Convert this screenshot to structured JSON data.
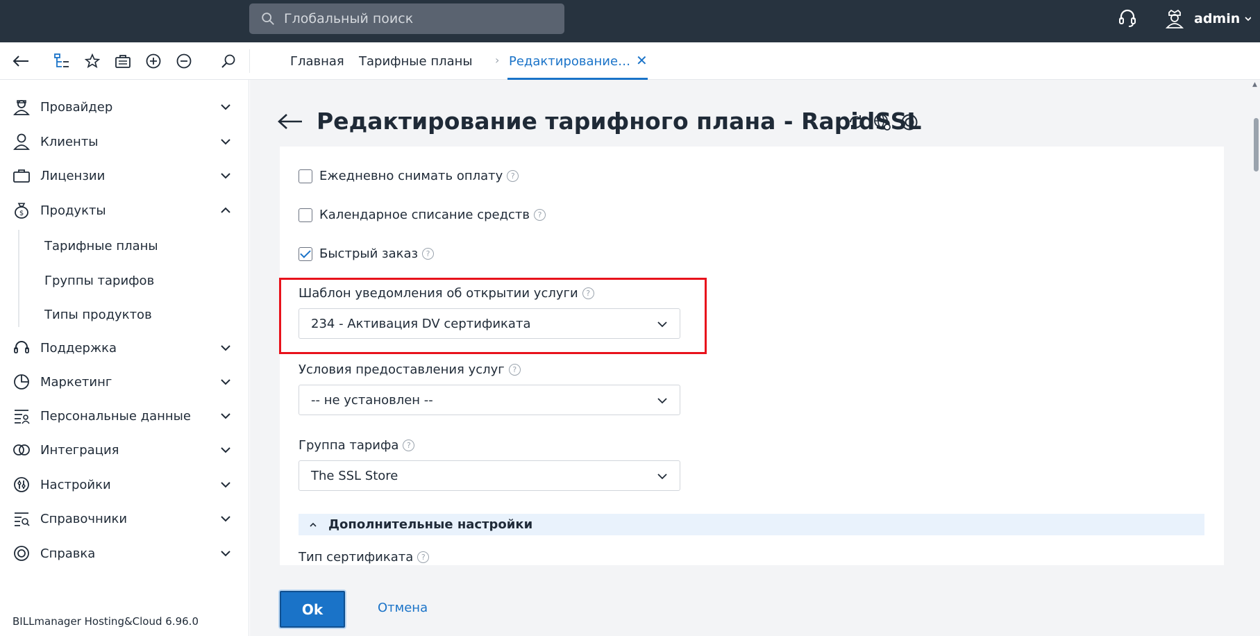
{
  "topbar": {
    "search_placeholder": "Глобальный поиск",
    "user_name": "admin"
  },
  "breadcrumbs": {
    "home": "Главная",
    "plans": "Тарифные планы",
    "current": "Редактирование…"
  },
  "sidebar": {
    "items": [
      {
        "label": "Провайдер",
        "icon": "provider-icon",
        "expanded": false
      },
      {
        "label": "Клиенты",
        "icon": "clients-icon",
        "expanded": false
      },
      {
        "label": "Лицензии",
        "icon": "licenses-icon",
        "expanded": false
      },
      {
        "label": "Продукты",
        "icon": "products-icon",
        "expanded": true
      },
      {
        "label": "Поддержка",
        "icon": "support-icon",
        "expanded": false
      },
      {
        "label": "Маркетинг",
        "icon": "marketing-icon",
        "expanded": false
      },
      {
        "label": "Персональные данные",
        "icon": "personal-data-icon",
        "expanded": false
      },
      {
        "label": "Интеграция",
        "icon": "integration-icon",
        "expanded": false
      },
      {
        "label": "Настройки",
        "icon": "settings-icon",
        "expanded": false
      },
      {
        "label": "Справочники",
        "icon": "references-icon",
        "expanded": false
      },
      {
        "label": "Справка",
        "icon": "help-icon",
        "expanded": false
      }
    ],
    "sub_items": [
      "Тарифные планы",
      "Группы тарифов",
      "Типы продуктов"
    ],
    "version": "BILLmanager Hosting&Cloud 6.96.0"
  },
  "page": {
    "title": "Редактирование тарифного плана - RapidSSL"
  },
  "form": {
    "daily_charge": {
      "label": "Ежедневно снимать оплату",
      "checked": false
    },
    "calendar_charge": {
      "label": "Календарное списание средств",
      "checked": false
    },
    "quick_order": {
      "label": "Быстрый заказ",
      "checked": true
    },
    "notify_template": {
      "label": "Шаблон уведомления об открытии услуги",
      "value": "234 - Активация DV сертификата"
    },
    "terms": {
      "label": "Условия предоставления услуг",
      "value": "-- не установлен --"
    },
    "plan_group": {
      "label": "Группа тарифа",
      "value": "The SSL Store"
    },
    "advanced_section": "Дополнительные настройки",
    "cert_type_label": "Тип сертификата"
  },
  "buttons": {
    "ok": "Ok",
    "cancel": "Отмена"
  },
  "colors": {
    "accent": "#1a73c8",
    "topbar": "#27333f",
    "highlight": "#e8121c"
  }
}
